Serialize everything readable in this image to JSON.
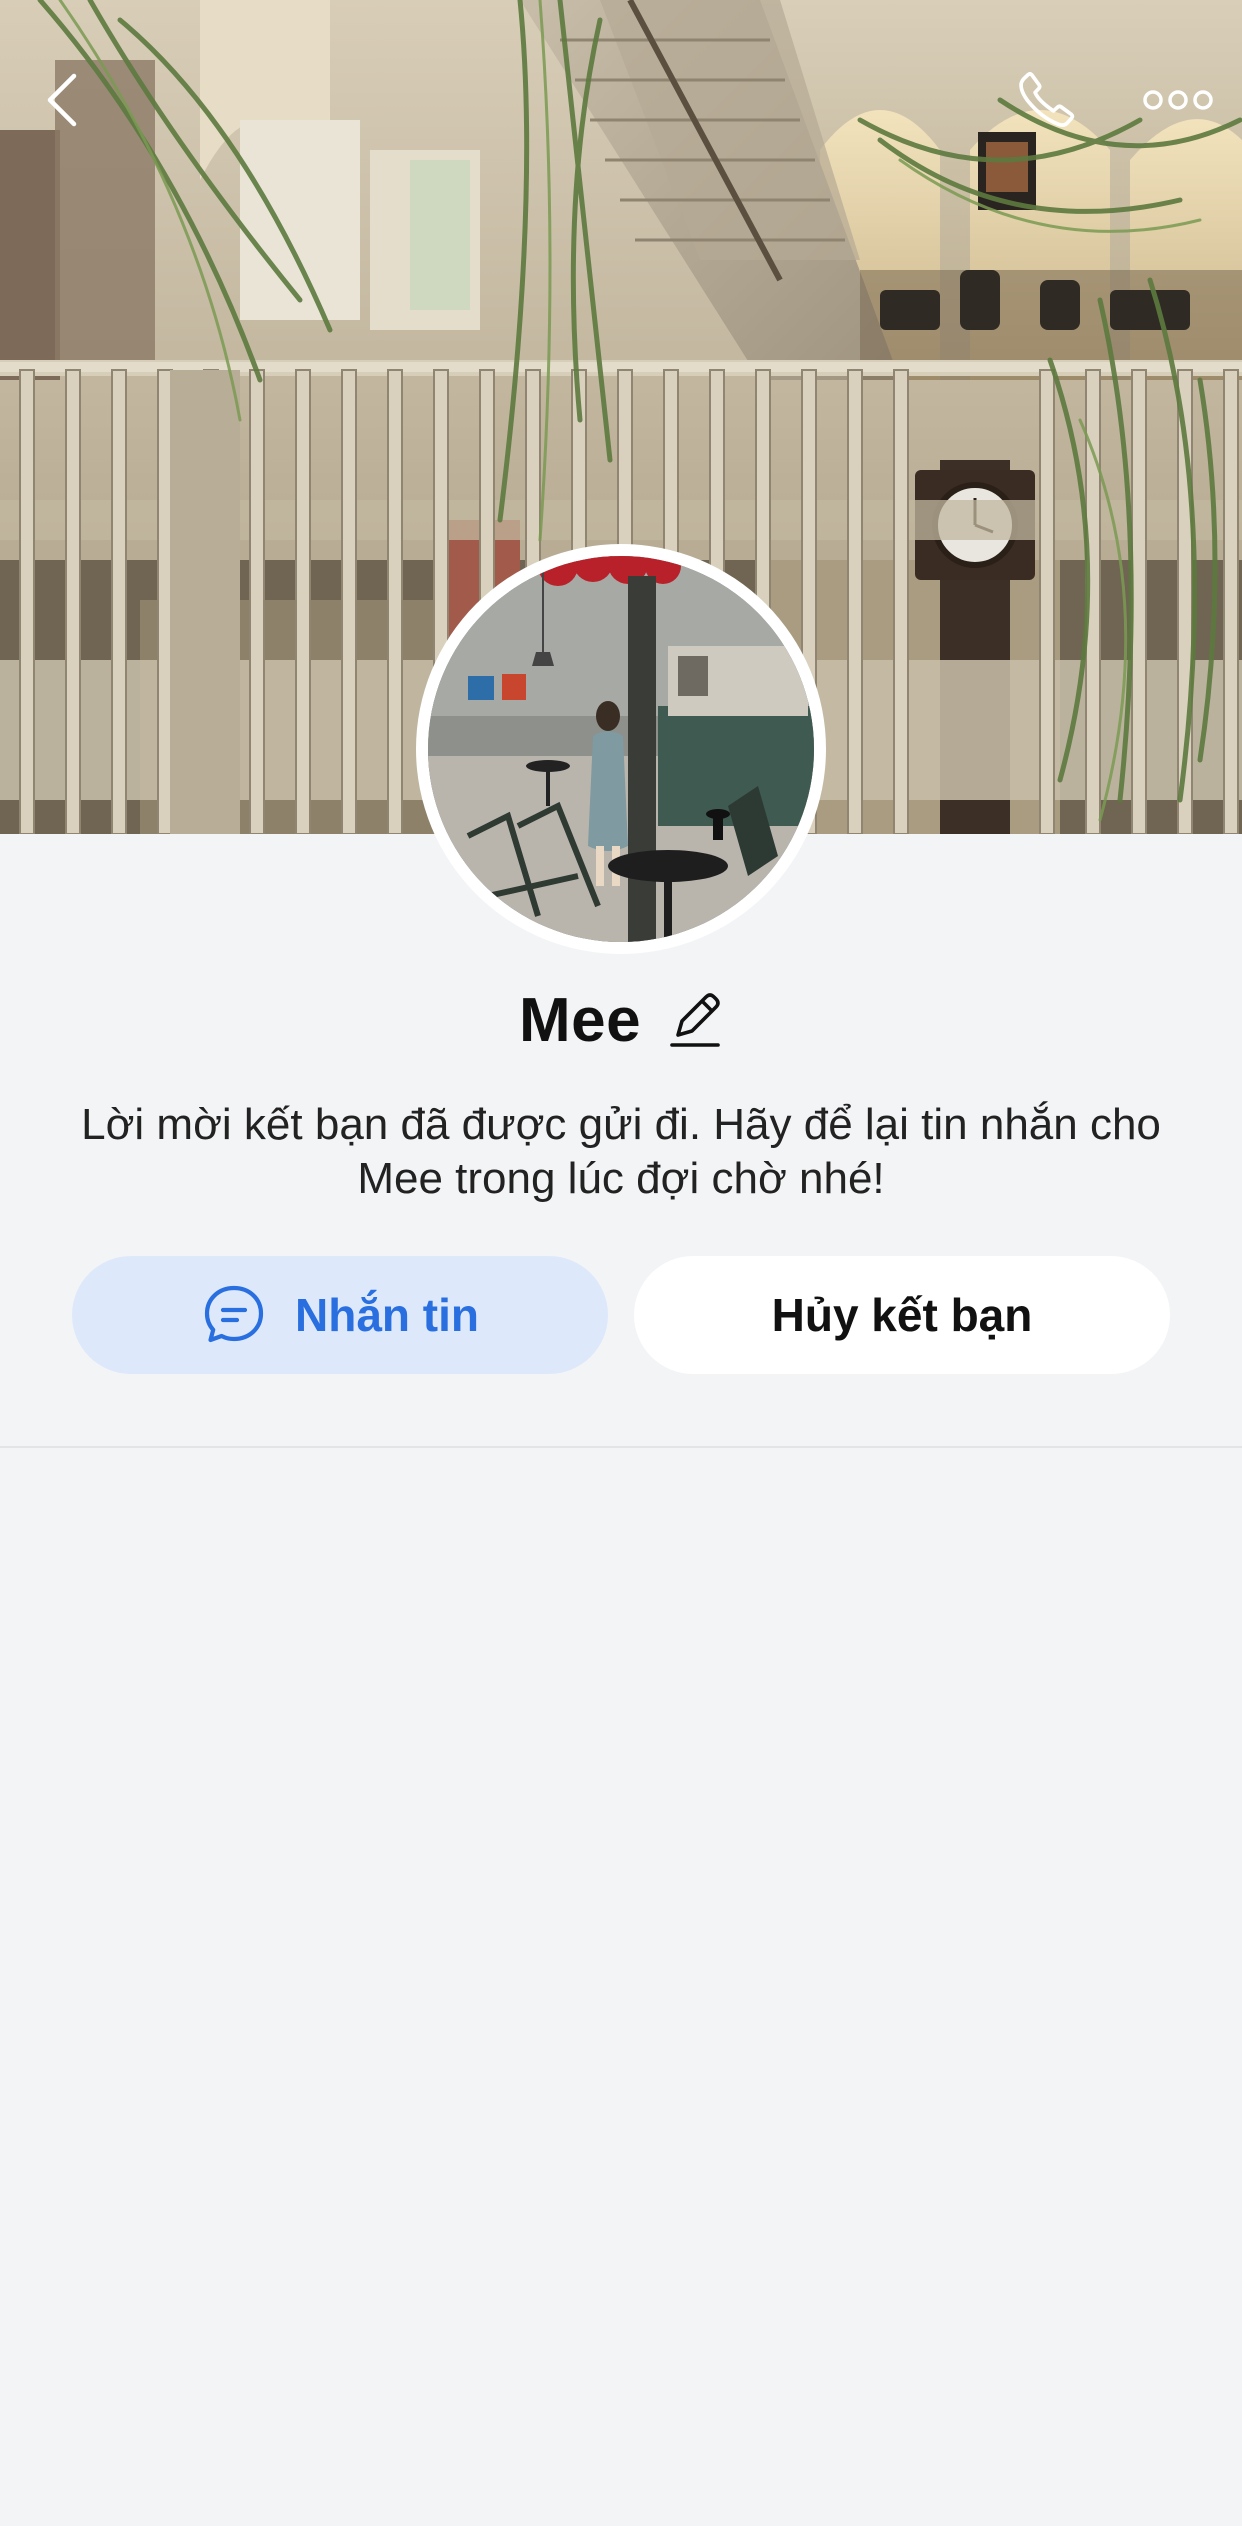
{
  "profile": {
    "name": "Mee",
    "status_message": "Lời mời kết bạn đã được gửi đi. Hãy để lại tin nhắn cho Mee trong lúc đợi chờ nhé!"
  },
  "actions": {
    "message_label": "Nhắn tin",
    "unfriend_label": "Hủy kết bạn"
  },
  "icons": {
    "back": "chevron-left-icon",
    "call": "phone-icon",
    "more": "more-dots-icon",
    "edit": "pencil-icon",
    "message": "chat-bubble-icon"
  },
  "colors": {
    "background": "#f3f4f6",
    "message_button_bg": "#dde9fb",
    "message_button_text": "#2a6fe0",
    "unfriend_button_bg": "#ffffff",
    "text_primary": "#111111"
  }
}
